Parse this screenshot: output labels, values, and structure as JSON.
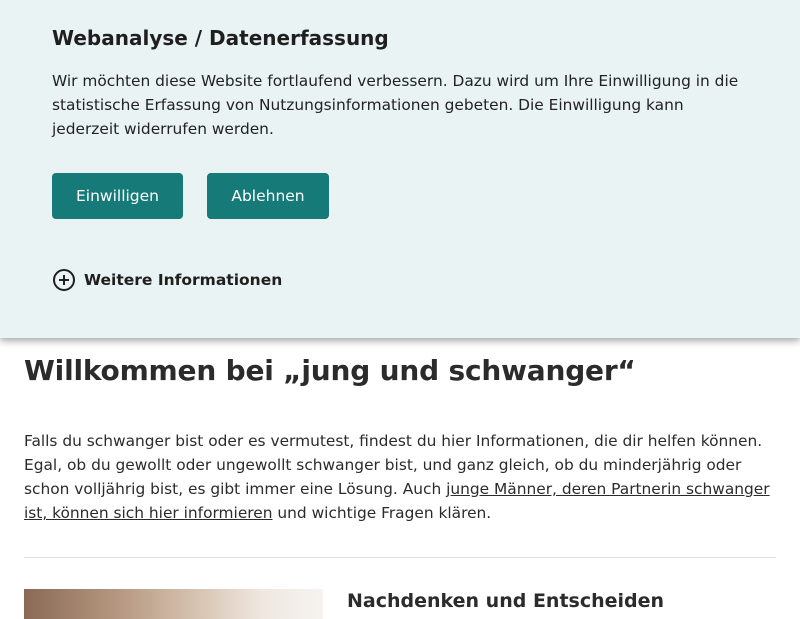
{
  "consent": {
    "title": "Webanalyse / Datenerfassung",
    "text": "Wir möchten diese Website fortlaufend verbessern. Dazu wird um Ihre Einwilligung in die statistische Erfassung von Nutzungsinformationen gebeten. Die Einwilligung kann jederzeit widerrufen werden.",
    "accept_label": "Einwilligen",
    "decline_label": "Ablehnen",
    "more_info_label": "Weitere Informationen",
    "more_info_icon": "plus-circle-icon",
    "accent_color": "#167a78",
    "background_color": "#eaf3f3"
  },
  "main": {
    "title": "Willkommen bei „jung und schwanger“",
    "intro_part1": "Falls du schwanger bist oder es vermutest, findest du hier Informationen, die dir helfen können. Egal, ob du gewollt oder ungewollt schwanger bist, und ganz gleich, ob du minderjährig oder schon volljährig bist, es gibt immer eine Lösung. Auch ",
    "intro_link": "junge Männer, deren Partnerin schwanger ist, können sich hier informieren",
    "intro_part2": " und wichtige Fragen klären.",
    "teaser_heading": "Nachdenken und Entscheiden"
  }
}
